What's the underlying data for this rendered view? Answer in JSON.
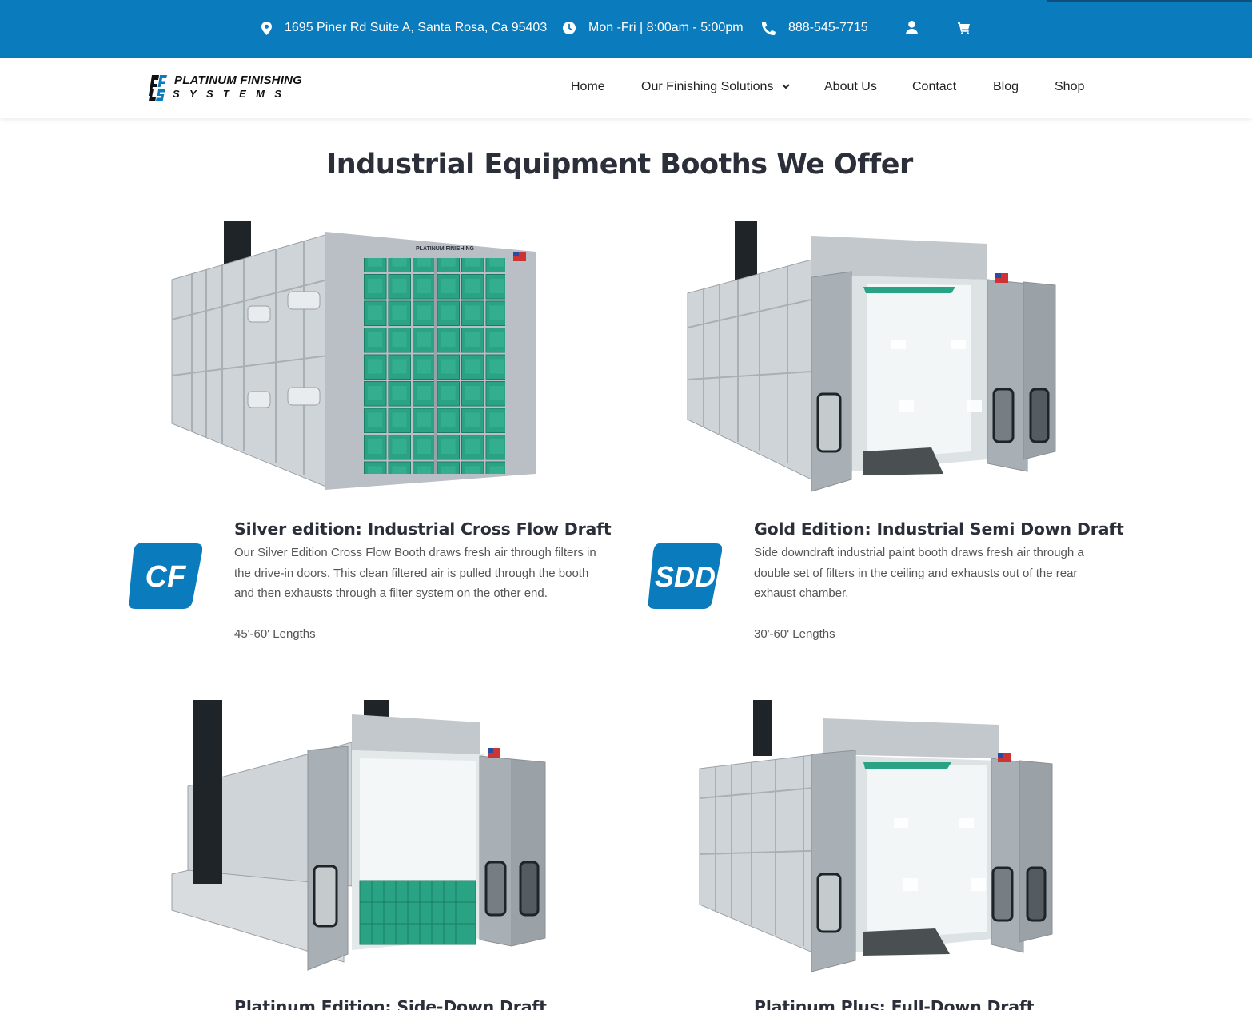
{
  "topbar": {
    "address": "1695 Piner Rd Suite A, Santa Rosa, Ca 95403",
    "hours": "Mon -Fri | 8:00am - 5:00pm",
    "phone": "888-545-7715",
    "icons": [
      "map-pin-icon",
      "clock-icon",
      "phone-icon",
      "user-icon",
      "cart-icon"
    ]
  },
  "logo": {
    "mark": "PFS",
    "line1": "PLATINUM FINISHING",
    "line2": "SYSTEMS"
  },
  "nav": {
    "items": [
      "Home",
      "Our Finishing Solutions",
      "About Us",
      "Contact",
      "Blog",
      "Shop"
    ]
  },
  "main": {
    "title": "Industrial Equipment Booths We Offer",
    "products": [
      {
        "badge": "CF",
        "title": "Silver edition: Industrial Cross Flow Draft",
        "description": "Our Silver Edition Cross Flow Booth draws fresh air through filters in the drive-in doors. This clean filtered air is pulled through the booth and then exhausts through a filter system on the other end.",
        "length": "45'-60' Lengths"
      },
      {
        "badge": "SDD",
        "title": "Gold Edition: Industrial Semi Down Draft",
        "description": "Side downdraft industrial paint booth draws fresh air through a double set of filters in the ceiling and exhausts out of the rear exhaust chamber.",
        "length": "30'-60' Lengths"
      },
      {
        "title": "Platinum Edition: Side-Down Draft"
      },
      {
        "title": "Platinum Plus: Full-Down Draft"
      }
    ]
  },
  "colors": {
    "brand_blue": "#0a7bbd",
    "filter_green": "#2aa385",
    "heading": "#2b2f3a"
  }
}
